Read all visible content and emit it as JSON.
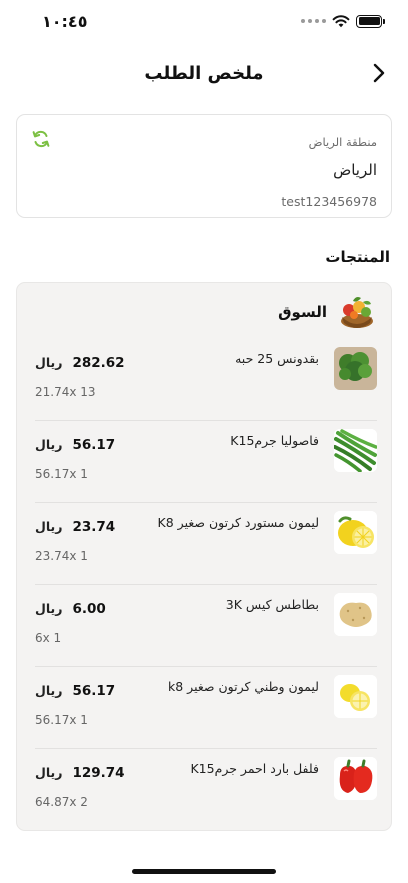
{
  "status_bar": {
    "time": "١٠:٤٥"
  },
  "header": {
    "title": "ملخص الطلب"
  },
  "location": {
    "label": "منطقة الرياض",
    "city": "الرياض",
    "code": "test123456978"
  },
  "products_section": {
    "title": "المنتجات"
  },
  "store": {
    "name": "السوق"
  },
  "currency": "ريال",
  "items": [
    {
      "name": "بقدونس 25 حبه",
      "price": "282.62",
      "qty": "21.74x 13",
      "icon": "parsley-image"
    },
    {
      "name": "فاصوليا جرمK15",
      "price": "56.17",
      "qty": "56.17x 1",
      "icon": "green-beans-image"
    },
    {
      "name": "ليمون مستورد كرتون صغير K8",
      "price": "23.74",
      "qty": "23.74x 1",
      "icon": "lemon-image"
    },
    {
      "name": "بطاطس كيس 3K",
      "price": "6.00",
      "qty": "6x 1",
      "icon": "potato-image"
    },
    {
      "name": "ليمون وطني كرتون صغير k8",
      "price": "56.17",
      "qty": "56.17x 1",
      "icon": "lemon-image"
    },
    {
      "name": "فلفل بارد احمر جرمK15",
      "price": "129.74",
      "qty": "64.87x 2",
      "icon": "red-pepper-image"
    }
  ],
  "colors": {
    "accent_green": "#8cc63f",
    "card_bg": "#f4f3f2"
  }
}
